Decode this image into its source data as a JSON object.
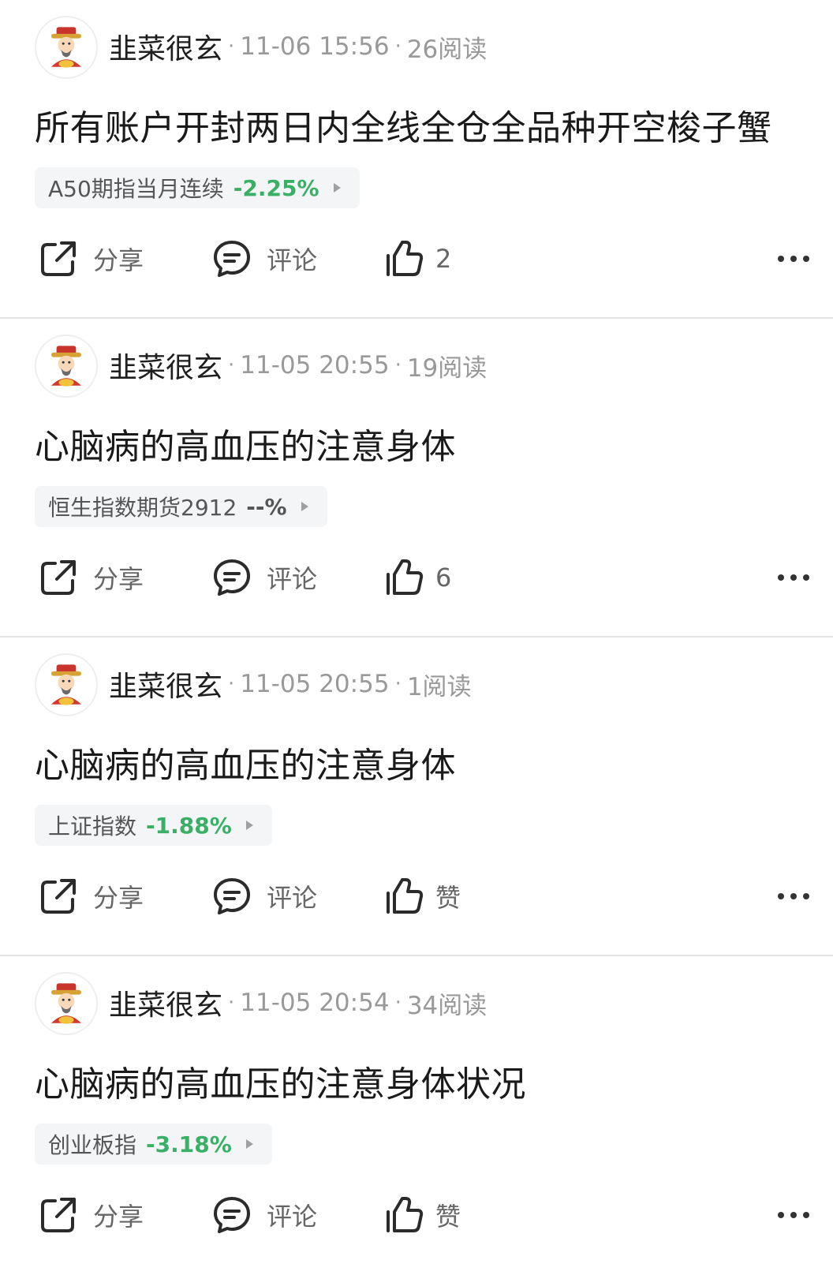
{
  "posts": [
    {
      "author": "韭菜很玄",
      "time": "11-06 15:56",
      "reads": "26阅读",
      "title": "所有账户开封两日内全线全仓全品种开空梭子蟹",
      "stock": {
        "name": "A50期指当月连续",
        "change": "-2.25%",
        "change_color": "#3ab067"
      },
      "share_label": "分享",
      "comment_label": "评论",
      "like_label": "2"
    },
    {
      "author": "韭菜很玄",
      "time": "11-05 20:55",
      "reads": "19阅读",
      "title": "心脑病的高血压的注意身体",
      "stock": {
        "name": "恒生指数期货2912",
        "change": "--%",
        "change_color": "#555555"
      },
      "share_label": "分享",
      "comment_label": "评论",
      "like_label": "6"
    },
    {
      "author": "韭菜很玄",
      "time": "11-05 20:55",
      "reads": "1阅读",
      "title": "心脑病的高血压的注意身体",
      "stock": {
        "name": "上证指数",
        "change": "-1.88%",
        "change_color": "#3ab067"
      },
      "share_label": "分享",
      "comment_label": "评论",
      "like_label": "赞"
    },
    {
      "author": "韭菜很玄",
      "time": "11-05 20:54",
      "reads": "34阅读",
      "title": "心脑病的高血压的注意身体状况",
      "stock": {
        "name": "创业板指",
        "change": "-3.18%",
        "change_color": "#3ab067"
      },
      "share_label": "分享",
      "comment_label": "评论",
      "like_label": "赞"
    }
  ],
  "icons": {
    "avatar": "fortune-god-avatar-icon",
    "share": "share-icon",
    "comment": "comment-icon",
    "like": "thumbs-up-icon",
    "more": "more-dots-icon",
    "tag_arrow": "caret-right-icon"
  },
  "colors": {
    "down": "#3ab067",
    "meta": "#999999",
    "divider": "#e3e3e3",
    "tag_bg": "#f4f5f7"
  }
}
